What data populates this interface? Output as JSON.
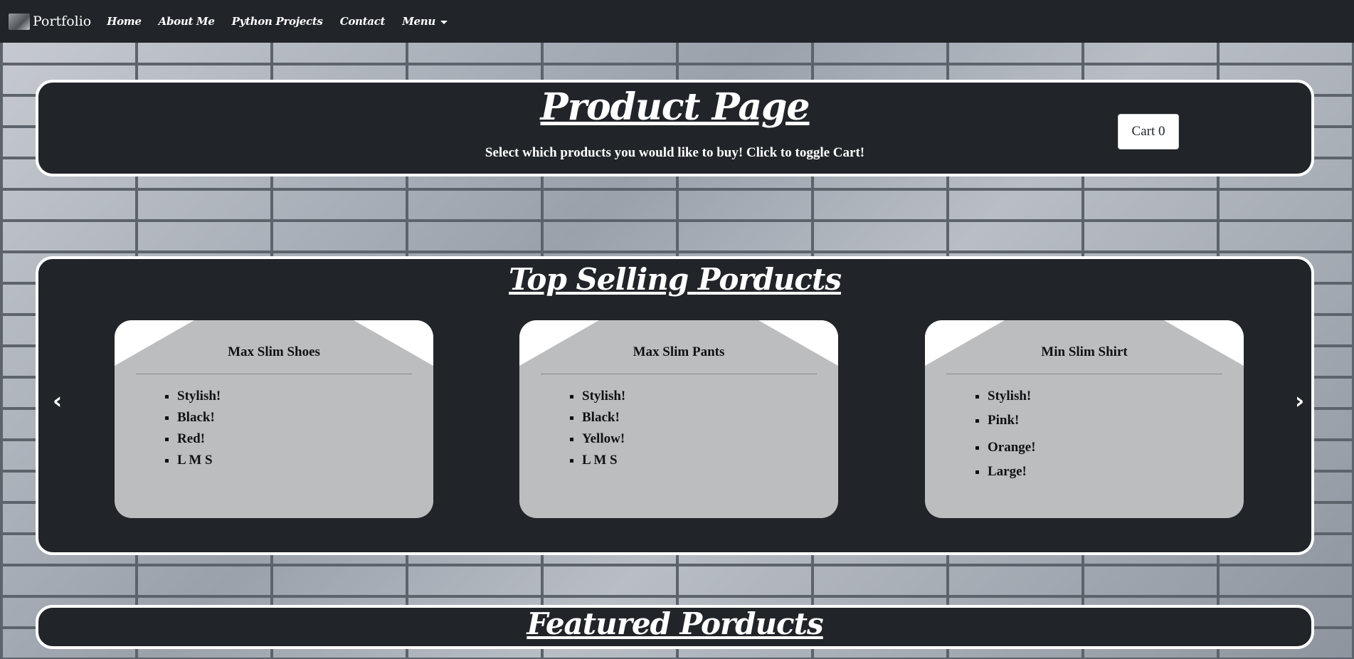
{
  "nav": {
    "brand": "Portfolio",
    "links": [
      "Home",
      "About Me",
      "Python Projects",
      "Contact"
    ],
    "menu_label": "Menu"
  },
  "hero": {
    "title": "Product Page",
    "subtitle": "Select which products you would like to buy! Click to toggle Cart!",
    "cart_label": "Cart 0"
  },
  "top_selling": {
    "title": "Top Selling Porducts",
    "prev_icon": "‹",
    "next_icon": "›",
    "cards": [
      {
        "title": "Max Slim Shoes",
        "items": [
          "Stylish!",
          "Black!",
          "Red!",
          "L M S"
        ]
      },
      {
        "title": "Max Slim Pants",
        "items": [
          "Stylish!",
          "Black!",
          "Yellow!",
          "L M S"
        ]
      },
      {
        "title": "Min Slim Shirt",
        "items": [
          "Stylish!",
          "Pink!",
          "Orange!",
          "Large!"
        ]
      }
    ]
  },
  "featured": {
    "title": "Featured Porducts"
  },
  "colors": {
    "panel": "#212529",
    "card": "#bcbdbf",
    "text": "#ffffff"
  }
}
